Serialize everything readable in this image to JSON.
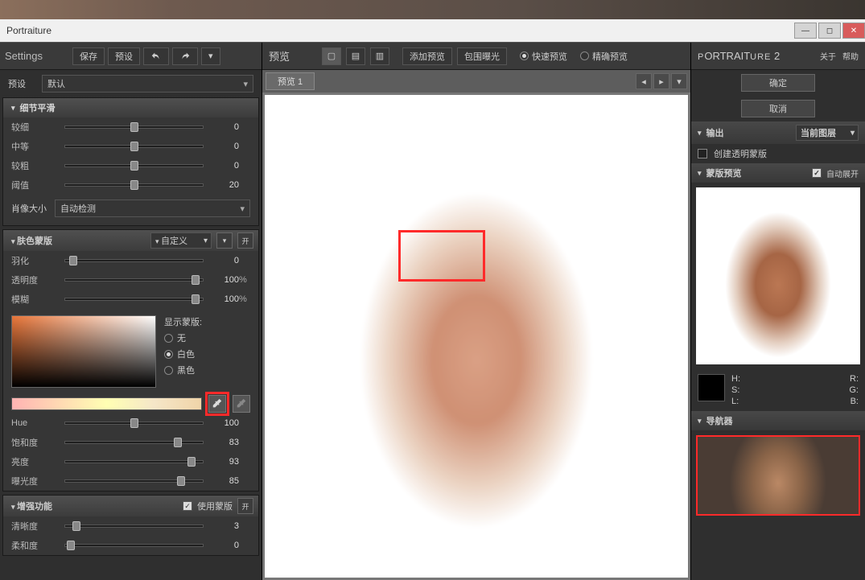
{
  "window_title": "Portraiture",
  "settings_panel": {
    "title": "Settings",
    "save_btn": "保存",
    "preset_btn": "预设",
    "preset_label": "预设",
    "preset_value": "默认",
    "detail_smooth_title": "细节平滑",
    "sliders_detail": [
      {
        "label": "较细",
        "value": 0,
        "pos": 50
      },
      {
        "label": "中等",
        "value": 0,
        "pos": 50
      },
      {
        "label": "较粗",
        "value": 0,
        "pos": 50
      },
      {
        "label": "阈值",
        "value": 20,
        "pos": 50
      }
    ],
    "portrait_size_label": "肖像大小",
    "portrait_size_value": "自动检测",
    "skin_mask_title": "肤色蒙版",
    "skin_mask_mode": "自定义",
    "skin_sliders_top": [
      {
        "label": "羽化",
        "value": 0,
        "units": "",
        "pos": 6
      },
      {
        "label": "透明度",
        "value": 100,
        "units": "%",
        "pos": 95
      },
      {
        "label": "模糊",
        "value": 100,
        "units": "%",
        "pos": 95
      }
    ],
    "show_mask_label": "显示蒙版:",
    "mask_options": [
      {
        "label": "无",
        "on": false
      },
      {
        "label": "白色",
        "on": true
      },
      {
        "label": "黑色",
        "on": false
      }
    ],
    "skin_sliders_bottom": [
      {
        "label": "Hue",
        "value": 100,
        "pos": 50
      },
      {
        "label": "饱和度",
        "value": 83,
        "pos": 82
      },
      {
        "label": "亮度",
        "value": 93,
        "pos": 92
      },
      {
        "label": "曝光度",
        "value": 85,
        "pos": 84
      }
    ],
    "enhance_title": "增强功能",
    "use_mask_label": "使用蒙版",
    "enhance_sliders": [
      {
        "label": "清晰度",
        "value": 3,
        "pos": 8
      },
      {
        "label": "柔和度",
        "value": 0,
        "pos": 4
      }
    ]
  },
  "preview_panel": {
    "title": "预览",
    "add_preview": "添加预览",
    "include_exposure": "包围曝光",
    "fast_preview": "快速预览",
    "precise_preview": "精确预览",
    "tab_label": "预览 1"
  },
  "right_panel": {
    "brand": "PORTRAITURE 2",
    "about": "关于",
    "help": "帮助",
    "ok": "确定",
    "cancel": "取消",
    "output_title": "输出",
    "output_value": "当前图层",
    "create_mask": "创建透明蒙版",
    "mask_preview_title": "蒙版预览",
    "auto_expand": "自动展开",
    "hsl": {
      "h": "H:",
      "s": "S:",
      "l": "L:",
      "r": "R:",
      "g": "G:",
      "b": "B:"
    },
    "navigator_title": "导航器"
  }
}
